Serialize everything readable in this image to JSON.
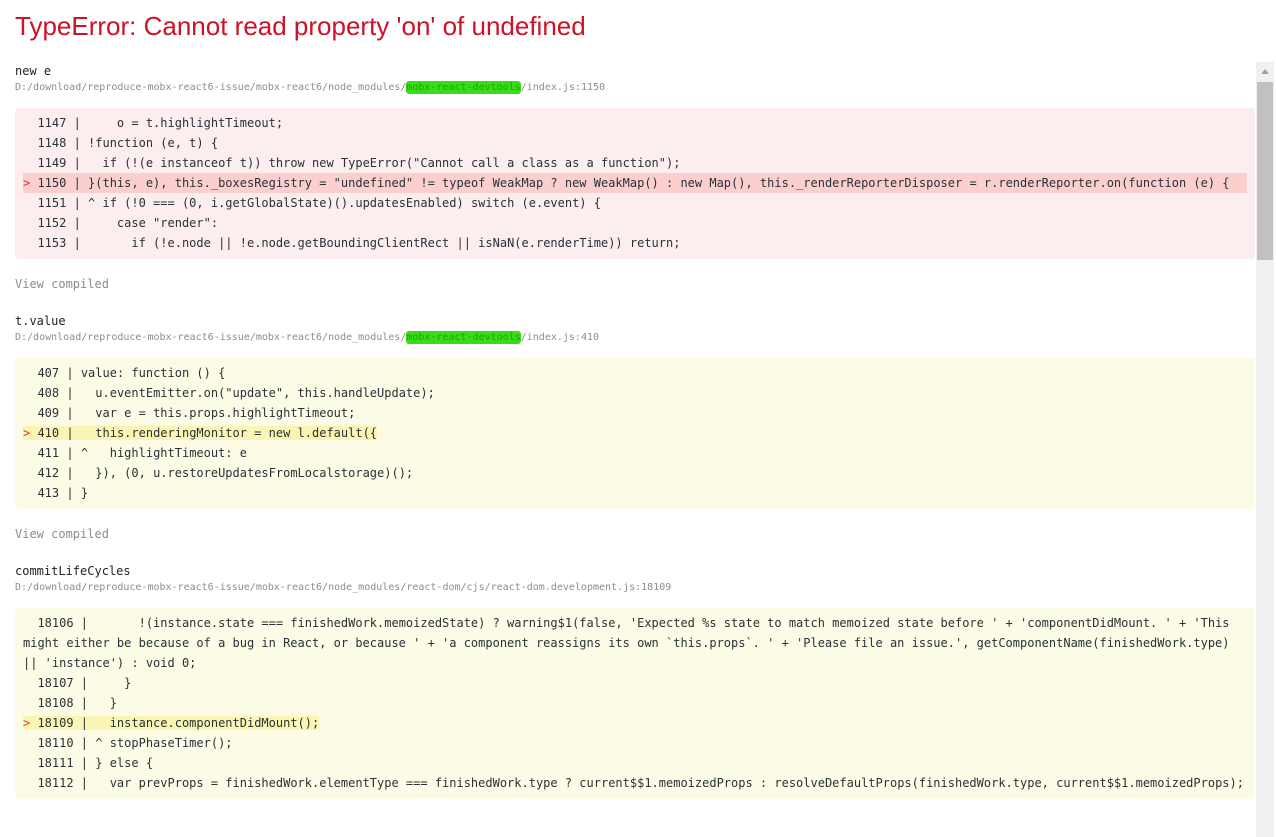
{
  "error_title": "TypeError: Cannot read property 'on' of undefined",
  "view_compiled_label": "View compiled",
  "frames": [
    {
      "function_name": "new e",
      "path_before": "D:/download/reproduce-mobx-react6-issue/mobx-react6/node_modules/",
      "path_highlight": "mobx-react-devtools",
      "path_after": "/index.js:1150",
      "lines": [
        {
          "num": "1147",
          "text": "     o = t.highlightTimeout;"
        },
        {
          "num": "1148",
          "text": " !function (e, t) {"
        },
        {
          "num": "1149",
          "text": "   if (!(e instanceof t)) throw new TypeError(\"Cannot call a class as a function\");"
        },
        {
          "num": "1150",
          "text": " }(this, e), this._boxesRegistry = \"undefined\" != typeof WeakMap ? new WeakMap() : new Map(), this._renderReporterDisposer = r.renderReporter.on(function (e) {"
        },
        {
          "num": "1151",
          "text": " ^ if (!0 === (0, i.getGlobalState)().updatesEnabled) switch (e.event) {"
        },
        {
          "num": "1152",
          "text": "     case \"render\":"
        },
        {
          "num": "1153",
          "text": "       if (!e.node || !e.node.getBoundingClientRect || isNaN(e.renderTime)) return;"
        }
      ]
    },
    {
      "function_name": "t.value",
      "path_before": "D:/download/reproduce-mobx-react6-issue/mobx-react6/node_modules/",
      "path_highlight": "mobx-react-devtools",
      "path_after": "/index.js:410",
      "lines": [
        {
          "num": "407",
          "text": " value: function () {"
        },
        {
          "num": "408",
          "text": "   u.eventEmitter.on(\"update\", this.handleUpdate);"
        },
        {
          "num": "409",
          "text": "   var e = this.props.highlightTimeout;"
        },
        {
          "num": "410",
          "text": "   this.renderingMonitor = new l.default({"
        },
        {
          "num": "411",
          "text": " ^   highlightTimeout: e"
        },
        {
          "num": "412",
          "text": "   }), (0, u.restoreUpdatesFromLocalstorage)();"
        },
        {
          "num": "413",
          "text": " }"
        }
      ]
    },
    {
      "function_name": "commitLifeCycles",
      "path_before": "D:/download/reproduce-mobx-react6-issue/mobx-react6/node_modules/react-dom/cjs/react-dom.development.js:18109",
      "path_highlight": "",
      "path_after": "",
      "lines": [
        {
          "num": "18106",
          "text": "       !(instance.state === finishedWork.memoizedState) ? warning$1(false, 'Expected %s state to match memoized state before ' + 'componentDidMount. ' + 'This might either be because of a bug in React, or because ' + 'a component reassigns its own `this.props`. ' + 'Please file an issue.', getComponentName(finishedWork.type) || 'instance') : void 0;"
        },
        {
          "num": "18107",
          "text": "     }"
        },
        {
          "num": "18108",
          "text": "   }"
        },
        {
          "num": "18109",
          "text": "   instance.componentDidMount();"
        },
        {
          "num": "18110",
          "text": " ^ stopPhaseTimer();"
        },
        {
          "num": "18111",
          "text": " } else {"
        },
        {
          "num": "18112",
          "text": "   var prevProps = finishedWork.elementType === finishedWork.type ? current$$1.memoizedProps : resolveDefaultProps(finishedWork.type, current$$1.memoizedProps);"
        }
      ]
    }
  ],
  "colors": {
    "error_title": "#ce1126",
    "path_highlight": "#39dd17",
    "error_frame_background": "#fcedef",
    "frame_background": "#fcfbe5"
  }
}
